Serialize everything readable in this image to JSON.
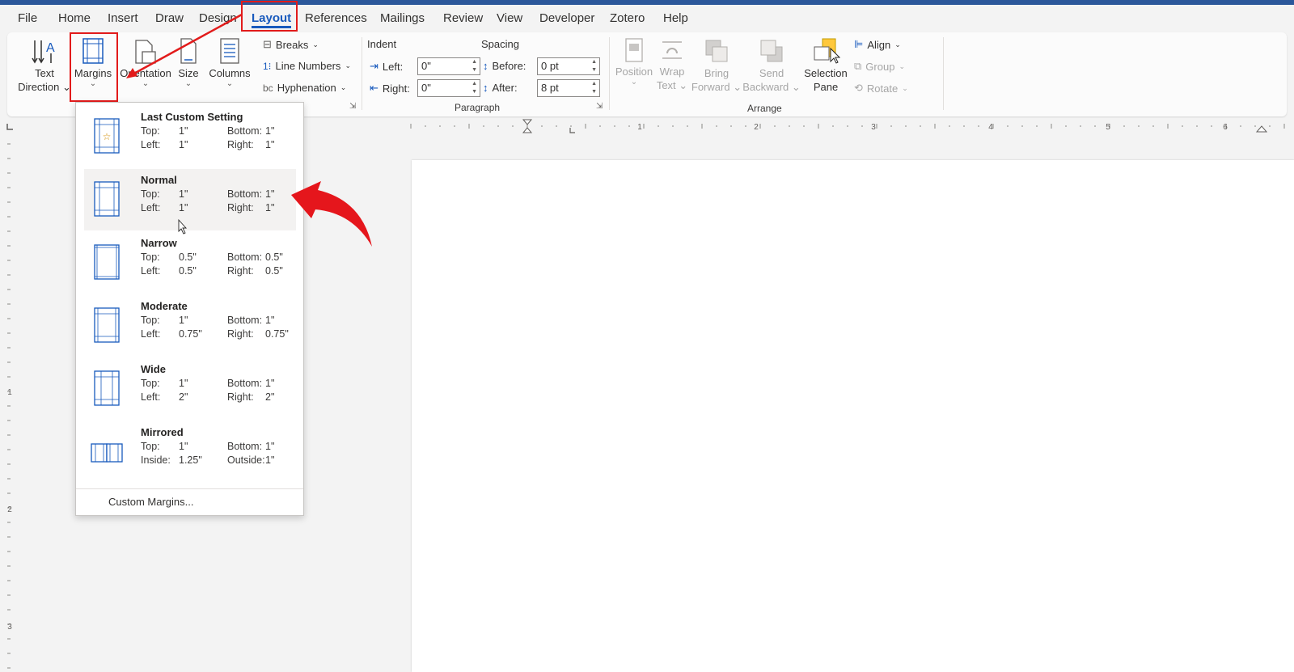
{
  "menu": {
    "tabs": [
      "File",
      "Home",
      "Insert",
      "Draw",
      "Design",
      "Layout",
      "References",
      "Mailings",
      "Review",
      "View",
      "Developer",
      "Zotero",
      "Help"
    ],
    "active_tab": "Layout"
  },
  "ribbon": {
    "text_direction": {
      "line1": "Text",
      "line2": "Direction"
    },
    "margins": "Margins",
    "orientation": "Orientation",
    "size": "Size",
    "columns": "Columns",
    "breaks": "Breaks",
    "line_numbers": "Line Numbers",
    "hyphenation": "Hyphenation",
    "indent": {
      "label": "Indent",
      "left_label": "Left:",
      "left_value": "0\"",
      "right_label": "Right:",
      "right_value": "0\""
    },
    "spacing": {
      "label": "Spacing",
      "before_label": "Before:",
      "before_value": "0 pt",
      "after_label": "After:",
      "after_value": "8 pt"
    },
    "paragraph_group": "Paragraph",
    "position": "Position",
    "wrap_text": {
      "line1": "Wrap",
      "line2": "Text"
    },
    "bring_forward": {
      "line1": "Bring",
      "line2": "Forward"
    },
    "send_backward": {
      "line1": "Send",
      "line2": "Backward"
    },
    "selection_pane": {
      "line1": "Selection",
      "line2": "Pane"
    },
    "align": "Align",
    "group": "Group",
    "rotate": "Rotate",
    "arrange_group": "Arrange"
  },
  "ruler": {
    "numbers": [
      "1",
      "2",
      "3",
      "4",
      "5",
      "6"
    ],
    "vertical_numbers": [
      "1",
      "2",
      "3"
    ]
  },
  "margins_menu": {
    "options": [
      {
        "title": "Last Custom Setting",
        "k1": "Top:",
        "v1": "1\"",
        "k2": "Bottom:",
        "v2": "1\"",
        "k3": "Left:",
        "v3": "1\"",
        "k4": "Right:",
        "v4": "1\""
      },
      {
        "title": "Normal",
        "k1": "Top:",
        "v1": "1\"",
        "k2": "Bottom:",
        "v2": "1\"",
        "k3": "Left:",
        "v3": "1\"",
        "k4": "Right:",
        "v4": "1\""
      },
      {
        "title": "Narrow",
        "k1": "Top:",
        "v1": "0.5\"",
        "k2": "Bottom:",
        "v2": "0.5\"",
        "k3": "Left:",
        "v3": "0.5\"",
        "k4": "Right:",
        "v4": "0.5\""
      },
      {
        "title": "Moderate",
        "k1": "Top:",
        "v1": "1\"",
        "k2": "Bottom:",
        "v2": "1\"",
        "k3": "Left:",
        "v3": "0.75\"",
        "k4": "Right:",
        "v4": "0.75\""
      },
      {
        "title": "Wide",
        "k1": "Top:",
        "v1": "1\"",
        "k2": "Bottom:",
        "v2": "1\"",
        "k3": "Left:",
        "v3": "2\"",
        "k4": "Right:",
        "v4": "2\""
      },
      {
        "title": "Mirrored",
        "k1": "Top:",
        "v1": "1\"",
        "k2": "Bottom:",
        "v2": "1\"",
        "k3": "Inside:",
        "v3": "1.25\"",
        "k4": "Outside:",
        "v4": "1\""
      }
    ],
    "custom": "Custom Margins..."
  },
  "colors": {
    "accent": "#185abd",
    "annotation": "#e21b1b",
    "title_bar": "#2b579a"
  }
}
